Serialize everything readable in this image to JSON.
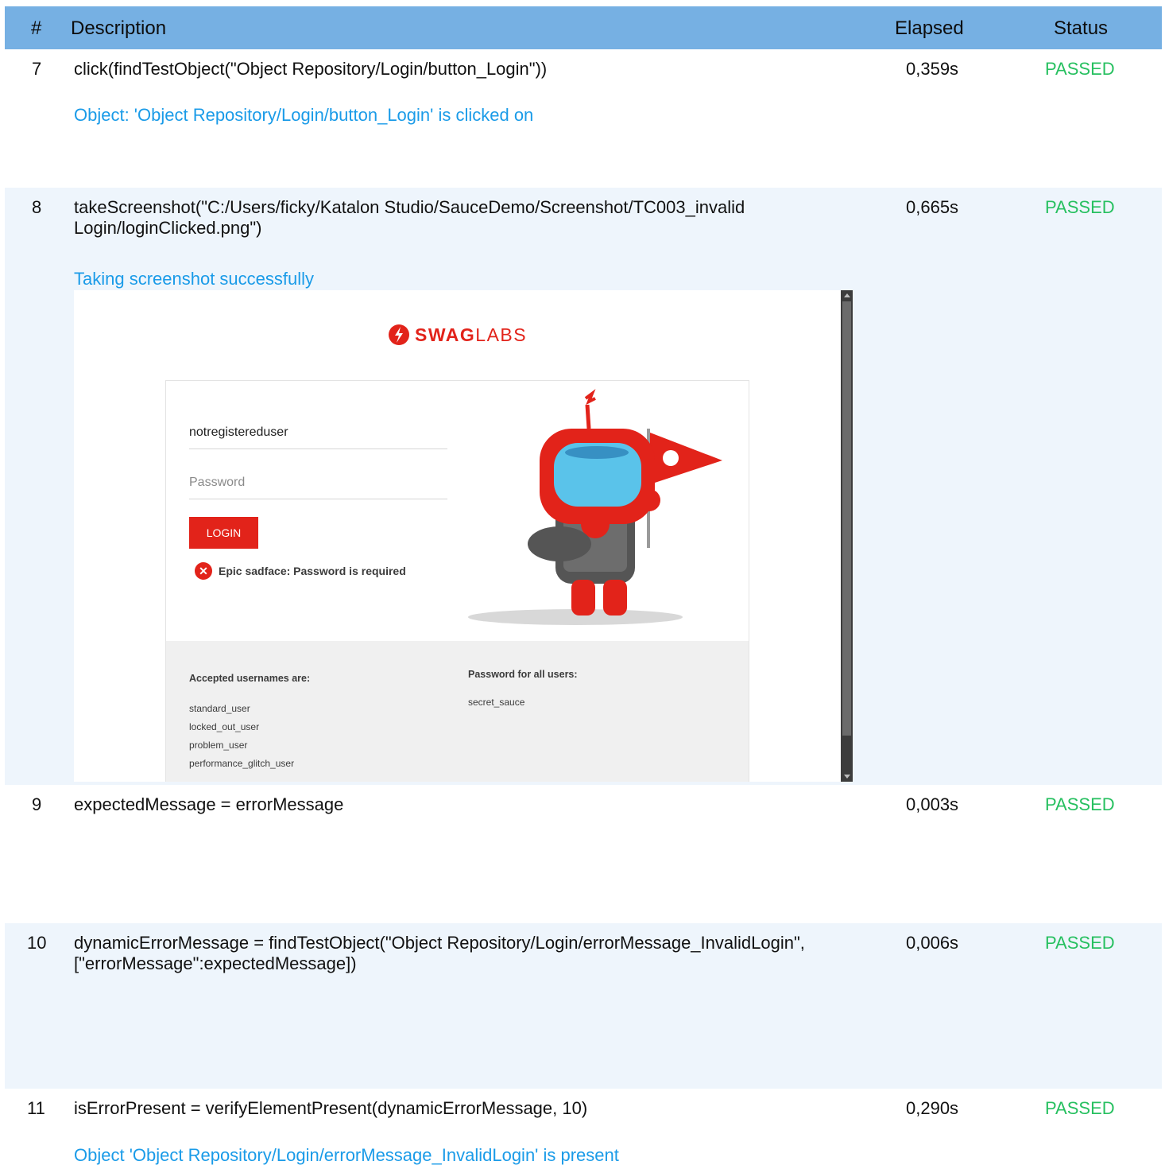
{
  "header": {
    "num": "#",
    "description": "Description",
    "elapsed": "Elapsed",
    "status": "Status"
  },
  "steps": [
    {
      "num": "7",
      "description": "click(findTestObject(\"Object Repository/Login/button_Login\"))",
      "elapsed": "0,359s",
      "status": "PASSED",
      "message": "Object: 'Object Repository/Login/button_Login' is clicked on"
    },
    {
      "num": "8",
      "description": "takeScreenshot(\"C:/Users/ficky/Katalon Studio/SauceDemo/Screenshot/TC003_invalid Login/loginClicked.png\")",
      "elapsed": "0,665s",
      "status": "PASSED",
      "message": "Taking screenshot successfully"
    },
    {
      "num": "9",
      "description": "expectedMessage = errorMessage",
      "elapsed": "0,003s",
      "status": "PASSED",
      "message": ""
    },
    {
      "num": "10",
      "description": "dynamicErrorMessage = findTestObject(\"Object Repository/Login/errorMessage_InvalidLogin\", [\"errorMessage\":expectedMessage])",
      "elapsed": "0,006s",
      "status": "PASSED",
      "message": ""
    },
    {
      "num": "11",
      "description": "isErrorPresent = verifyElementPresent(dynamicErrorMessage, 10)",
      "elapsed": "0,290s",
      "status": "PASSED",
      "message": "Object 'Object Repository/Login/errorMessage_InvalidLogin' is present"
    }
  ],
  "screenshot": {
    "logo_bold": "SWAG",
    "logo_light": "LABS",
    "username_value": "notregistereduser",
    "password_placeholder": "Password",
    "login_label": "LOGIN",
    "error_text": "Epic sadface: Password is required",
    "usernames_heading": "Accepted usernames are:",
    "usernames": [
      "standard_user",
      "locked_out_user",
      "problem_user",
      "performance_glitch_user"
    ],
    "password_heading": "Password for all users:",
    "password_value": "secret_sauce"
  },
  "colors": {
    "header_bg": "#76b0e3",
    "passed": "#27c060",
    "message": "#1a9be8",
    "brand_red": "#e2231a",
    "row_alt": "#eef5fc"
  }
}
